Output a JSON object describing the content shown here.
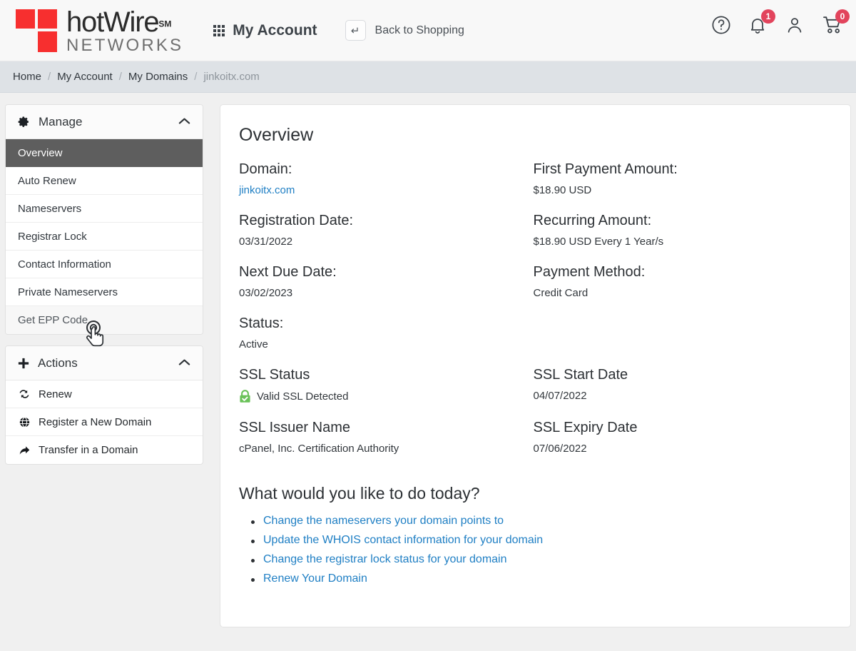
{
  "brand": {
    "name_top": "hotWire",
    "name_sm": "SM",
    "name_bottom": "NETWORKS",
    "square_color": "#f72f2f"
  },
  "header": {
    "my_account_label": "My Account",
    "grid_icon": "grid-apps-icon",
    "back_to_shopping_label": "Back to Shopping",
    "return_glyph": "↵",
    "icons": [
      {
        "name": "help-icon",
        "badge": null
      },
      {
        "name": "bell-icon",
        "badge": "1"
      },
      {
        "name": "user-icon",
        "badge": null
      },
      {
        "name": "cart-icon",
        "badge": "0"
      }
    ],
    "badge_color": "#e2445c"
  },
  "breadcrumb": {
    "separator": "/",
    "items": [
      {
        "label": "Home",
        "current": false
      },
      {
        "label": "My Account",
        "current": false
      },
      {
        "label": "My Domains",
        "current": false
      },
      {
        "label": "jinkoitx.com",
        "current": true
      }
    ]
  },
  "sidebar": {
    "manage": {
      "title": "Manage",
      "icon": "gear-icon",
      "chevron": "chevron-up-icon",
      "items": [
        {
          "label": "Overview",
          "state": "active"
        },
        {
          "label": "Auto Renew",
          "state": "normal"
        },
        {
          "label": "Nameservers",
          "state": "normal"
        },
        {
          "label": "Registrar Lock",
          "state": "normal"
        },
        {
          "label": "Contact Information",
          "state": "normal"
        },
        {
          "label": "Private Nameservers",
          "state": "normal"
        },
        {
          "label": "Get EPP Code",
          "state": "hovered"
        }
      ]
    },
    "actions": {
      "title": "Actions",
      "icon": "plus-icon",
      "chevron": "chevron-up-icon",
      "items": [
        {
          "label": "Renew",
          "icon": "sync-icon"
        },
        {
          "label": "Register a New Domain",
          "icon": "globe-icon"
        },
        {
          "label": "Transfer in a Domain",
          "icon": "share-arrow-icon"
        }
      ]
    }
  },
  "main": {
    "heading": "Overview",
    "fields": [
      {
        "label": "Domain:",
        "value": "jinkoitx.com",
        "style": "link"
      },
      {
        "label": "First Payment Amount:",
        "value": "$18.90 USD",
        "style": "text"
      },
      {
        "label": "Registration Date:",
        "value": "03/31/2022",
        "style": "text"
      },
      {
        "label": "Recurring Amount:",
        "value": "$18.90 USD Every 1 Year/s",
        "style": "text"
      },
      {
        "label": "Next Due Date:",
        "value": "03/02/2023",
        "style": "text"
      },
      {
        "label": "Payment Method:",
        "value": "Credit Card",
        "style": "text"
      },
      {
        "label": "Status:",
        "value": "Active",
        "style": "text"
      }
    ],
    "ssl": {
      "status_label": "SSL Status",
      "status_value": "Valid SSL Detected",
      "status_icon": "green-padlock-check-icon",
      "start_label": "SSL Start Date",
      "start_value": "04/07/2022",
      "issuer_label": "SSL Issuer Name",
      "issuer_value": "cPanel, Inc. Certification Authority",
      "expiry_label": "SSL Expiry Date",
      "expiry_value": "07/06/2022",
      "lock_color": "#6ac259"
    },
    "today": {
      "heading": "What would you like to do today?",
      "links": [
        "Change the nameservers your domain points to",
        "Update the WHOIS contact information for your domain",
        "Change the registrar lock status for your domain",
        "Renew Your Domain"
      ]
    },
    "link_color": "#1f7fc4"
  }
}
